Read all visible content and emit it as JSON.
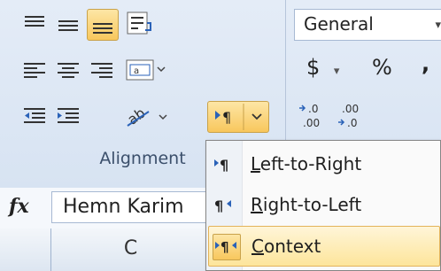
{
  "alignment_group": {
    "label": "Alignment"
  },
  "number_group": {
    "format_value": "General",
    "currency_symbol": "$",
    "percent_symbol": "%",
    "comma_symbol": ","
  },
  "formula_bar": {
    "fx_label": "fx",
    "value": "Hemn Karim"
  },
  "columns": {
    "c": "C"
  },
  "direction_menu": {
    "items": [
      {
        "accel": "L",
        "rest": "eft-to-Right"
      },
      {
        "accel": "R",
        "rest": "ight-to-Left"
      },
      {
        "accel": "C",
        "rest": "ontext"
      }
    ]
  }
}
